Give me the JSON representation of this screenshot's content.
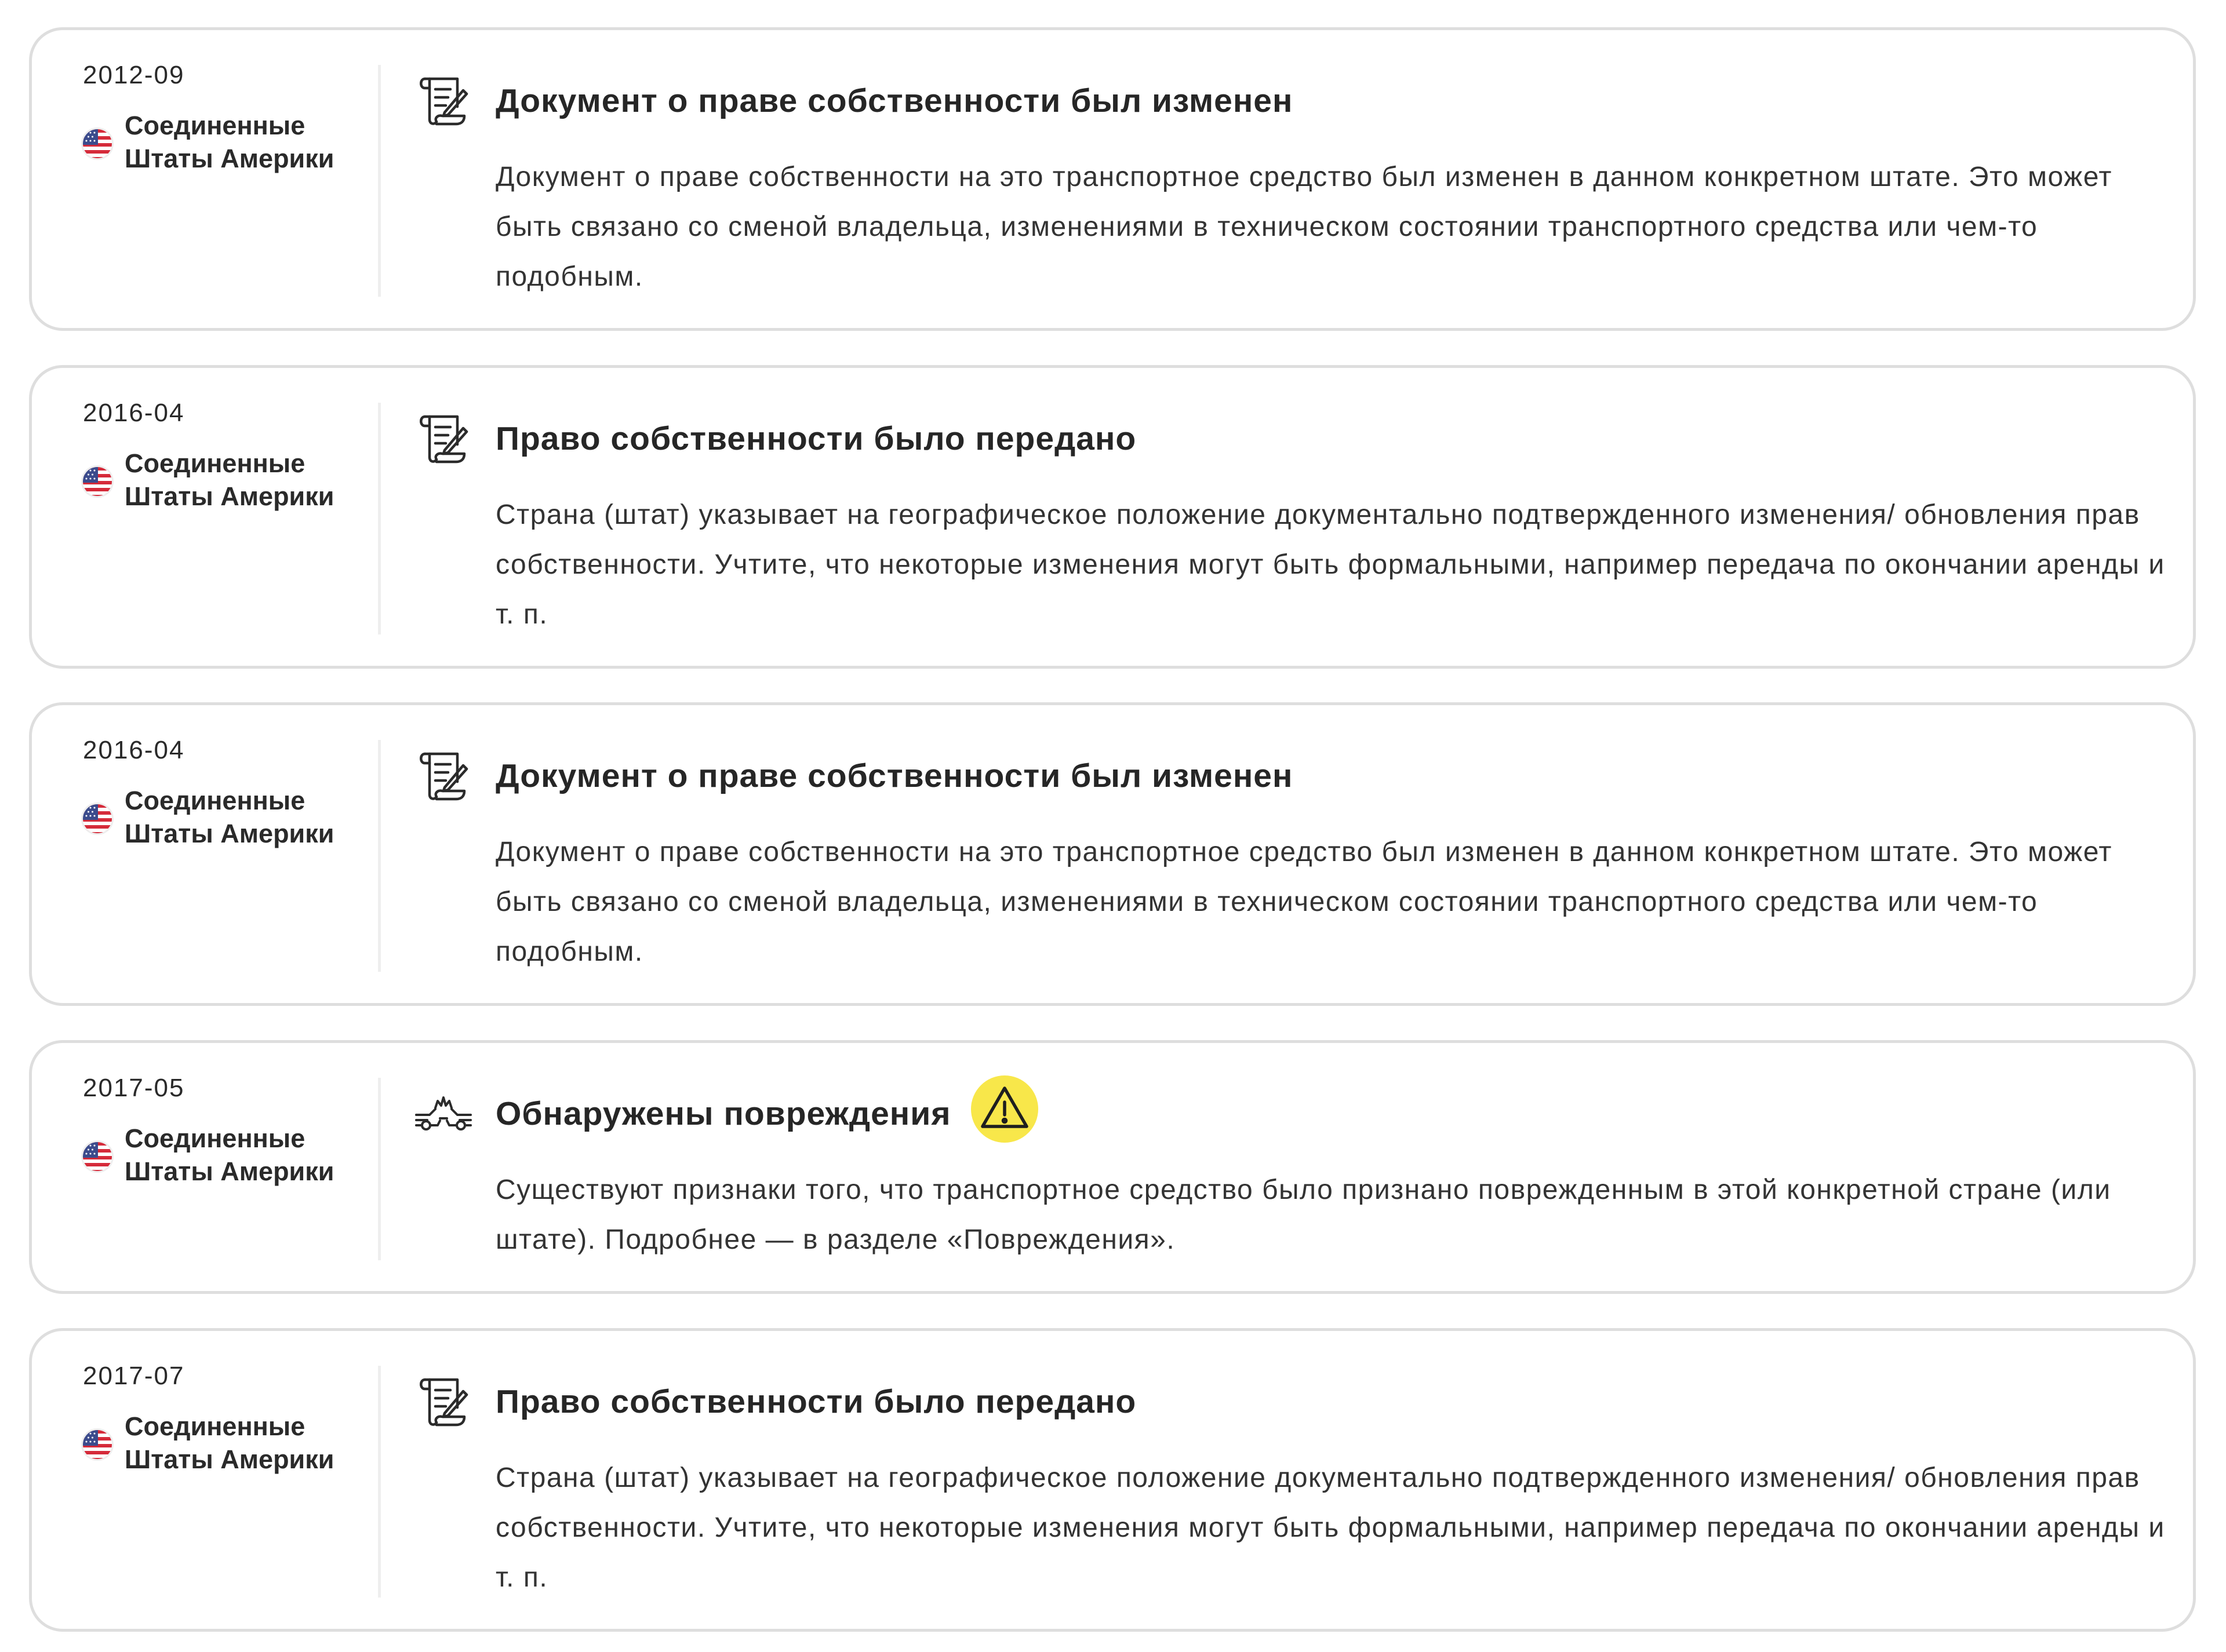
{
  "colors": {
    "card_border": "#dedede",
    "divider": "#eeeeee",
    "warning_badge": "#f8e74a",
    "text_primary": "#262626",
    "text_secondary": "#333333"
  },
  "events": [
    {
      "date": "2012-09",
      "country": "Соединенные Штаты Америки",
      "flag_icon": "us-flag-icon",
      "icon": "title-document-icon",
      "title": "Документ о праве собственности был изменен",
      "description": "Документ о праве собственности на это транспортное средство был изменен в данном конкретном штате. Это может быть связано со сменой владельца, изменениями в техническом состоянии транспортного средства или чем-то подобным.",
      "warning": false
    },
    {
      "date": "2016-04",
      "country": "Соединенные Штаты Америки",
      "flag_icon": "us-flag-icon",
      "icon": "title-document-icon",
      "title": "Право собственности было передано",
      "description": "Страна (штат) указывает на географическое положение документально подтвержденного изменения/ обновления прав собственности. Учтите, что некоторые изменения могут быть формальными, например передача по окончании аренды и т. п.",
      "warning": false
    },
    {
      "date": "2016-04",
      "country": "Соединенные Штаты Америки",
      "flag_icon": "us-flag-icon",
      "icon": "title-document-icon",
      "title": "Документ о праве собственности был изменен",
      "description": "Документ о праве собственности на это транспортное средство был изменен в данном конкретном штате. Это может быть связано со сменой владельца, изменениями в техническом состоянии транспортного средства или чем-то подобным.",
      "warning": false
    },
    {
      "date": "2017-05",
      "country": "Соединенные Штаты Америки",
      "flag_icon": "us-flag-icon",
      "icon": "car-crash-icon",
      "title": "Обнаружены повреждения",
      "description": "Существуют признаки того, что транспортное средство было признано поврежденным в этой конкретной стране (или штате). Подробнее — в разделе «Повреждения».",
      "warning": true,
      "warning_icon": "warning-triangle-icon"
    },
    {
      "date": "2017-07",
      "country": "Соединенные Штаты Америки",
      "flag_icon": "us-flag-icon",
      "icon": "title-document-icon",
      "title": "Право собственности было передано",
      "description": "Страна (штат) указывает на географическое положение документально подтвержденного изменения/ обновления прав собственности. Учтите, что некоторые изменения могут быть формальными, например передача по окончании аренды и т. п.",
      "warning": false
    }
  ]
}
